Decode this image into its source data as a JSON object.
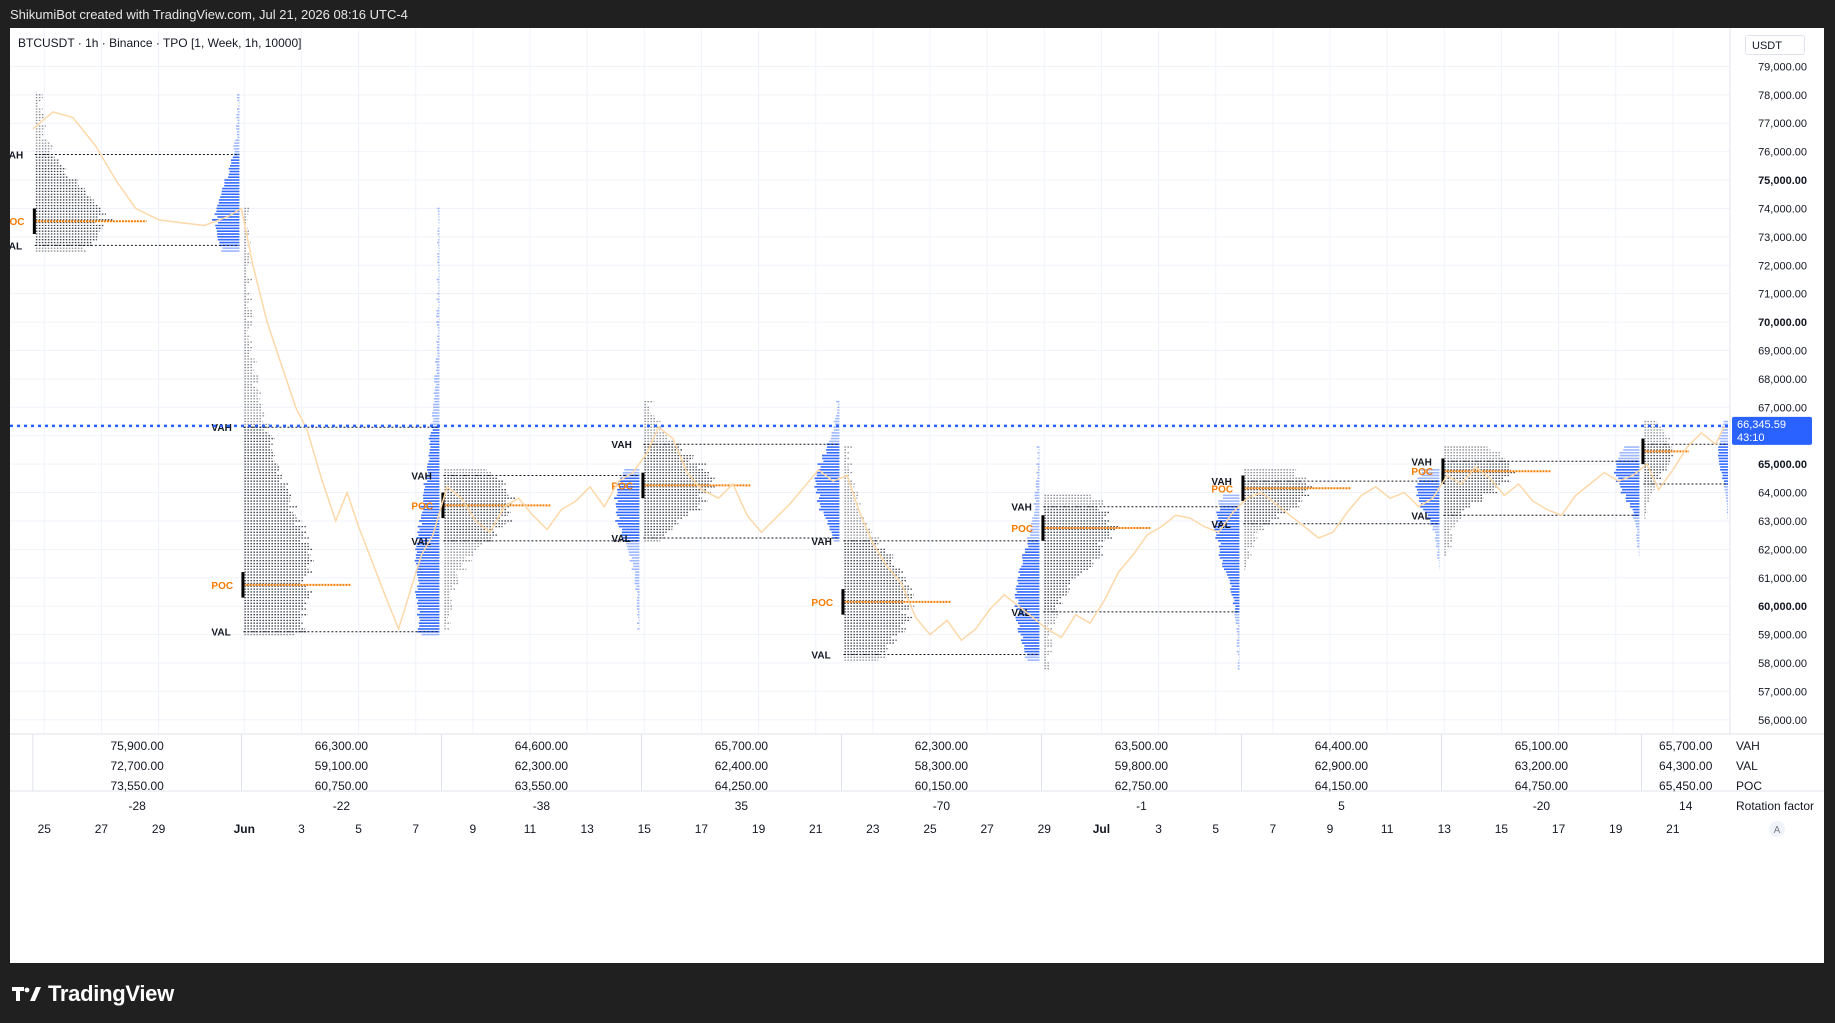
{
  "header": {
    "attribution": "ShikumiBot created with TradingView.com, Jul 21, 2026 08:16 UTC-4"
  },
  "legend": {
    "text": "BTCUSDT · 1h · Binance · TPO [1, Week, 1h, 10000]"
  },
  "currency": "USDT",
  "footer": {
    "brand": "TradingView"
  },
  "colors": {
    "poc": "#f57c00",
    "tpo_dots": "#2a2e39",
    "profile_blue": "#2962ff",
    "price_line": "#fdd8a8",
    "current_price": "#2962ff",
    "va_line": "#131722"
  },
  "chart_data": {
    "type": "tpo-profile",
    "symbol": "BTCUSDT",
    "interval": "1h",
    "exchange": "Binance",
    "y_axis": {
      "ylim": [
        55500,
        80000
      ],
      "ticks": [
        56000,
        57000,
        58000,
        59000,
        60000,
        61000,
        62000,
        63000,
        64000,
        65000,
        66000,
        67000,
        68000,
        69000,
        70000,
        71000,
        72000,
        73000,
        74000,
        75000,
        76000,
        77000,
        78000,
        79000
      ],
      "tick_labels": [
        "56,000.00",
        "57,000.00",
        "58,000.00",
        "59,000.00",
        "60,000.00",
        "61,000.00",
        "62,000.00",
        "63,000.00",
        "64,000.00",
        "65,000.00",
        "66,000.00",
        "67,000.00",
        "68,000.00",
        "69,000.00",
        "70,000.00",
        "71,000.00",
        "72,000.00",
        "73,000.00",
        "74,000.00",
        "75,000.00",
        "76,000.00",
        "77,000.00",
        "78,000.00",
        "79,000.00"
      ],
      "bold_ticks": [
        60000,
        65000,
        70000,
        75000
      ]
    },
    "x_axis": {
      "ticks": [
        {
          "day": 25,
          "label": "25"
        },
        {
          "day": 27,
          "label": "27"
        },
        {
          "day": 29,
          "label": "29"
        },
        {
          "day": 32,
          "label": "Jun"
        },
        {
          "day": 34,
          "label": "3"
        },
        {
          "day": 36,
          "label": "5"
        },
        {
          "day": 38,
          "label": "7"
        },
        {
          "day": 40,
          "label": "9"
        },
        {
          "day": 42,
          "label": "11"
        },
        {
          "day": 44,
          "label": "13"
        },
        {
          "day": 46,
          "label": "15"
        },
        {
          "day": 48,
          "label": "17"
        },
        {
          "day": 50,
          "label": "19"
        },
        {
          "day": 52,
          "label": "21"
        },
        {
          "day": 54,
          "label": "23"
        },
        {
          "day": 56,
          "label": "25"
        },
        {
          "day": 58,
          "label": "27"
        },
        {
          "day": 60,
          "label": "29"
        },
        {
          "day": 62,
          "label": "Jul"
        },
        {
          "day": 64,
          "label": "3"
        },
        {
          "day": 66,
          "label": "5"
        },
        {
          "day": 68,
          "label": "7"
        },
        {
          "day": 70,
          "label": "9"
        },
        {
          "day": 72,
          "label": "11"
        },
        {
          "day": 74,
          "label": "13"
        },
        {
          "day": 76,
          "label": "15"
        },
        {
          "day": 78,
          "label": "17"
        },
        {
          "day": 80,
          "label": "19"
        },
        {
          "day": 82,
          "label": "21"
        }
      ],
      "bold_labels": [
        "Jun",
        "Jul"
      ],
      "range_days": [
        23.8,
        84
      ]
    },
    "current_price": {
      "label": "66,345.59",
      "value": 66345.59,
      "countdown": "43:10"
    },
    "stats_row_labels": {
      "vah": "VAH",
      "val": "VAL",
      "poc": "POC",
      "rotation": "Rotation factor"
    },
    "auto_scale_label": "A",
    "weeks": [
      {
        "start": 24.6,
        "vah": "75,900.00",
        "val": "72,700.00",
        "poc": "73,550.00",
        "rotation": "-28",
        "vahv": 75900,
        "valv": 72700,
        "pocv": 73550,
        "low": 72500,
        "high": 78100,
        "left_labels": true
      },
      {
        "start": 31.9,
        "vah": "66,300.00",
        "val": "59,100.00",
        "poc": "60,750.00",
        "rotation": "-22",
        "vahv": 66300,
        "valv": 59100,
        "pocv": 60750,
        "low": 59000,
        "high": 74000,
        "left_labels": true
      },
      {
        "start": 38.9,
        "vah": "64,600.00",
        "val": "62,300.00",
        "poc": "63,550.00",
        "rotation": "-38",
        "vahv": 64600,
        "valv": 62300,
        "pocv": 63550,
        "low": 59200,
        "high": 64800,
        "left_labels": true
      },
      {
        "start": 45.9,
        "vah": "65,700.00",
        "val": "62,400.00",
        "poc": "64,250.00",
        "rotation": "35",
        "vahv": 65700,
        "valv": 62400,
        "pocv": 64250,
        "low": 62300,
        "high": 67200,
        "left_labels": true
      },
      {
        "start": 52.9,
        "vah": "62,300.00",
        "val": "58,300.00",
        "poc": "60,150.00",
        "rotation": "-70",
        "vahv": 62300,
        "valv": 58300,
        "pocv": 60150,
        "low": 58100,
        "high": 65600,
        "left_labels": true
      },
      {
        "start": 59.9,
        "vah": "63,500.00",
        "val": "59,800.00",
        "poc": "62,750.00",
        "rotation": "-1",
        "vahv": 63500,
        "valv": 59800,
        "pocv": 62750,
        "low": 57800,
        "high": 63900,
        "left_labels": true
      },
      {
        "start": 66.9,
        "vah": "64,400.00",
        "val": "62,900.00",
        "poc": "64,150.00",
        "rotation": "5",
        "vahv": 64400,
        "valv": 62900,
        "pocv": 64150,
        "low": 61300,
        "high": 64800,
        "left_labels": true
      },
      {
        "start": 73.9,
        "vah": "65,100.00",
        "val": "63,200.00",
        "poc": "64,750.00",
        "rotation": "-20",
        "vahv": 65100,
        "valv": 63200,
        "pocv": 64750,
        "low": 61800,
        "high": 65600,
        "left_labels": true
      },
      {
        "start": 80.9,
        "vah": "65,700.00",
        "val": "64,300.00",
        "poc": "65,450.00",
        "rotation": "14",
        "vahv": 65700,
        "valv": 64300,
        "pocv": 65450,
        "low": 63100,
        "high": 66500,
        "left_labels": false
      }
    ],
    "price_path": [
      [
        24.6,
        76800
      ],
      [
        25.3,
        77400
      ],
      [
        26,
        77200
      ],
      [
        26.8,
        76200
      ],
      [
        27.5,
        75000
      ],
      [
        28.2,
        74000
      ],
      [
        29,
        73600
      ],
      [
        29.8,
        73500
      ],
      [
        30.6,
        73400
      ],
      [
        31.4,
        73700
      ],
      [
        31.9,
        74000
      ],
      [
        32.3,
        72000
      ],
      [
        32.8,
        70000
      ],
      [
        33.3,
        68500
      ],
      [
        33.8,
        67000
      ],
      [
        34.2,
        66200
      ],
      [
        34.7,
        64500
      ],
      [
        35.2,
        63000
      ],
      [
        35.6,
        64000
      ],
      [
        36,
        62800
      ],
      [
        36.5,
        61500
      ],
      [
        37,
        60200
      ],
      [
        37.4,
        59200
      ],
      [
        37.8,
        60500
      ],
      [
        38.2,
        61800
      ],
      [
        38.6,
        62500
      ],
      [
        39.1,
        64200
      ],
      [
        39.6,
        63800
      ],
      [
        40.1,
        63000
      ],
      [
        40.6,
        62600
      ],
      [
        41.1,
        63500
      ],
      [
        41.6,
        63800
      ],
      [
        42.1,
        63200
      ],
      [
        42.6,
        62700
      ],
      [
        43.1,
        63400
      ],
      [
        43.6,
        63700
      ],
      [
        44.1,
        64200
      ],
      [
        44.6,
        63500
      ],
      [
        45.1,
        64400
      ],
      [
        45.6,
        64700
      ],
      [
        46.1,
        65400
      ],
      [
        46.5,
        66300
      ],
      [
        47,
        65900
      ],
      [
        47.5,
        64700
      ],
      [
        48,
        64100
      ],
      [
        48.6,
        63800
      ],
      [
        49.1,
        64300
      ],
      [
        49.6,
        63200
      ],
      [
        50.1,
        62600
      ],
      [
        50.6,
        63100
      ],
      [
        51.1,
        63600
      ],
      [
        51.6,
        64200
      ],
      [
        52.1,
        64800
      ],
      [
        52.6,
        64400
      ],
      [
        53.1,
        64600
      ],
      [
        53.5,
        63400
      ],
      [
        54,
        62200
      ],
      [
        54.5,
        61400
      ],
      [
        55,
        60800
      ],
      [
        55.5,
        59600
      ],
      [
        56,
        59000
      ],
      [
        56.6,
        59500
      ],
      [
        57.1,
        58800
      ],
      [
        57.6,
        59200
      ],
      [
        58.1,
        59900
      ],
      [
        58.6,
        60400
      ],
      [
        59.1,
        60000
      ],
      [
        59.6,
        59600
      ],
      [
        60.1,
        59200
      ],
      [
        60.6,
        58900
      ],
      [
        61.1,
        59700
      ],
      [
        61.6,
        59400
      ],
      [
        62.1,
        60200
      ],
      [
        62.6,
        61200
      ],
      [
        63.1,
        61800
      ],
      [
        63.6,
        62500
      ],
      [
        64.1,
        62800
      ],
      [
        64.6,
        63200
      ],
      [
        65.1,
        63100
      ],
      [
        65.6,
        62800
      ],
      [
        66.1,
        62600
      ],
      [
        66.6,
        63300
      ],
      [
        67.1,
        63800
      ],
      [
        67.6,
        64000
      ],
      [
        68.1,
        63600
      ],
      [
        68.6,
        63200
      ],
      [
        69.1,
        62800
      ],
      [
        69.6,
        62400
      ],
      [
        70.1,
        62600
      ],
      [
        70.6,
        63300
      ],
      [
        71.1,
        63900
      ],
      [
        71.6,
        64200
      ],
      [
        72.1,
        63800
      ],
      [
        72.6,
        64000
      ],
      [
        73.1,
        63500
      ],
      [
        73.6,
        63800
      ],
      [
        74.1,
        64600
      ],
      [
        74.6,
        64300
      ],
      [
        75.1,
        64900
      ],
      [
        75.6,
        64500
      ],
      [
        76.1,
        63900
      ],
      [
        76.6,
        64300
      ],
      [
        77.1,
        63700
      ],
      [
        77.6,
        63400
      ],
      [
        78.1,
        63200
      ],
      [
        78.6,
        63900
      ],
      [
        79.1,
        64300
      ],
      [
        79.6,
        64700
      ],
      [
        80.1,
        64400
      ],
      [
        80.6,
        64600
      ],
      [
        81.1,
        65000
      ],
      [
        81.5,
        64100
      ],
      [
        82,
        64800
      ],
      [
        82.5,
        65600
      ],
      [
        83,
        66100
      ],
      [
        83.5,
        65700
      ],
      [
        83.8,
        66345
      ]
    ]
  }
}
